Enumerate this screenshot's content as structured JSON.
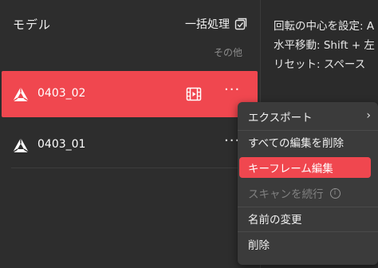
{
  "panel": {
    "title": "モデル",
    "batch_label": "一括処理",
    "other_label": "その他"
  },
  "models": [
    {
      "name": "0403_02",
      "selected": true
    },
    {
      "name": "0403_01",
      "selected": false
    }
  ],
  "more_glyph": "···",
  "info_lines": [
    "回転の中心を設定: A",
    "水平移動: Shift + 左",
    "リセット: スペース"
  ],
  "context_menu": {
    "items": [
      {
        "label": "エクスポート",
        "has_submenu": true
      },
      {
        "label": "すべての編集を削除"
      },
      {
        "label": "キーフレーム編集",
        "highlighted": true
      },
      {
        "label": "スキャンを続行",
        "disabled": true,
        "info": "i"
      },
      {
        "label": "名前の変更"
      },
      {
        "label": "削除"
      }
    ]
  },
  "colors": {
    "accent": "#f0474f",
    "background": "#2b2b2b",
    "menu_background": "#3b3b3b"
  }
}
